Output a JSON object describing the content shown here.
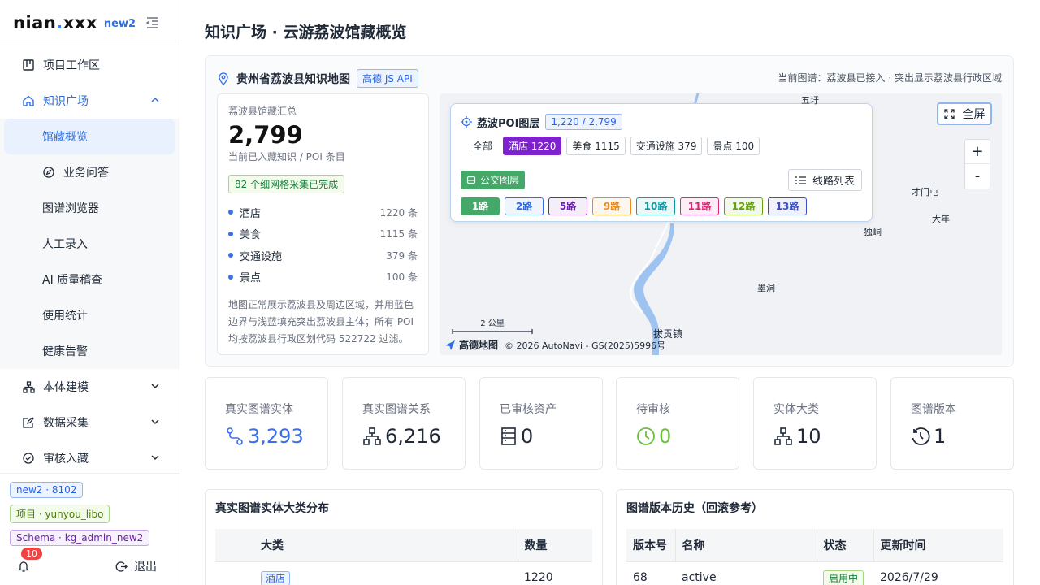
{
  "brand": {
    "name_a": "nian",
    "name_dot": ".",
    "name_b": "xxx",
    "tag": "new2"
  },
  "menu": {
    "items": [
      {
        "label": "项目工作区"
      },
      {
        "label": "知识广场"
      },
      {
        "label": "馆藏概览"
      },
      {
        "label": "业务问答"
      },
      {
        "label": "图谱浏览器"
      },
      {
        "label": "人工录入"
      },
      {
        "label": "AI 质量稽查"
      },
      {
        "label": "使用统计"
      },
      {
        "label": "健康告警"
      },
      {
        "label": "本体建模"
      },
      {
        "label": "数据采集"
      },
      {
        "label": "审核入藏"
      }
    ]
  },
  "footer": {
    "env_pill": "new2 · 8102",
    "project_pill": "项目 · yunyou_libo",
    "schema_pill": "Schema · kg_admin_new2",
    "notif_count": "10",
    "logout": "退出"
  },
  "page": {
    "title": "知识广场 · 云游荔波馆藏概览"
  },
  "map": {
    "title": "贵州省荔波县知识地图",
    "api_tag": "高德 JS API",
    "note": "当前图谱：荔波县已接入 · 突出显示荔波县行政区域",
    "summary": {
      "label": "荔波县馆藏汇总",
      "total": "2,799",
      "sub": "当前已入藏知识 / POI 条目",
      "chip": "82 个细网格采集已完成",
      "rows": [
        {
          "name": "酒店",
          "count": "1220 条"
        },
        {
          "name": "美食",
          "count": "1115 条"
        },
        {
          "name": "交通设施",
          "count": "379 条"
        },
        {
          "name": "景点",
          "count": "100 条"
        }
      ],
      "desc": "地图正常展示荔波县及周边区域，并用蓝色边界与浅蓝填充突出荔波县主体；所有 POI 均按荔波县行政区划代码 522722 过滤。"
    },
    "poi": {
      "title": "荔波POI图层",
      "count": "1,220 / 2,799",
      "cats": [
        "全部",
        "酒店 1220",
        "美食 1115",
        "交通设施 379",
        "景点 100"
      ],
      "bus": "公交图层",
      "route_list": "线路列表",
      "routes": [
        {
          "label": "1路",
          "color": "#43a868"
        },
        {
          "label": "2路",
          "color": "#2f6fe0"
        },
        {
          "label": "5路",
          "color": "#6b21a8"
        },
        {
          "label": "9路",
          "color": "#ea8a1c"
        },
        {
          "label": "10路",
          "color": "#0e9aa7"
        },
        {
          "label": "11路",
          "color": "#db2777"
        },
        {
          "label": "12路",
          "color": "#65a30d"
        },
        {
          "label": "13路",
          "color": "#3b4fc4"
        }
      ]
    },
    "fullscreen": "全屏",
    "zoom_in": "+",
    "zoom_out": "-",
    "places": [
      "五圩",
      "才门屯",
      "大年",
      "独峒",
      "墨洞",
      "拔贡镇"
    ],
    "scale": "2 公里",
    "amap_logo": "高德地图",
    "copyright": "© 2026 AutoNavi - GS(2025)5996号"
  },
  "stats": [
    {
      "label": "真实图谱实体",
      "value": "3,293",
      "color": "#3b6ee8",
      "icon": "network-icon"
    },
    {
      "label": "真实图谱关系",
      "value": "6,216",
      "color": "#1f2937",
      "icon": "hierarchy-icon"
    },
    {
      "label": "已审核资产",
      "value": "0",
      "color": "#1f2937",
      "icon": "list-icon"
    },
    {
      "label": "待审核",
      "value": "0",
      "color": "#6bbf3a",
      "icon": "clock-icon"
    },
    {
      "label": "实体大类",
      "value": "10",
      "color": "#1f2937",
      "icon": "hierarchy-icon"
    },
    {
      "label": "图谱版本",
      "value": "1",
      "color": "#1f2937",
      "icon": "history-icon"
    }
  ],
  "dist": {
    "title": "真实图谱实体大类分布",
    "headers": [
      "大类",
      "数量"
    ],
    "rows": [
      {
        "category": "酒店",
        "count": "1220"
      }
    ]
  },
  "versions": {
    "title": "图谱版本历史（回滚参考）",
    "headers": [
      "版本号",
      "名称",
      "状态",
      "更新时间"
    ],
    "rows": [
      {
        "version": "68",
        "name": "active",
        "status": "启用中",
        "updated": "2026/7/29"
      }
    ]
  }
}
